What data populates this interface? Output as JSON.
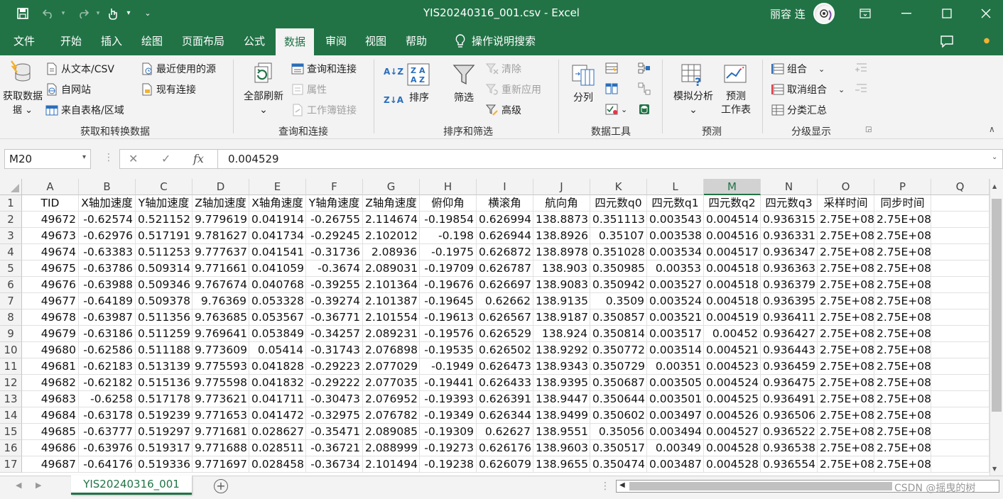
{
  "app": {
    "title": "YIS20240316_001.csv  -  Excel",
    "user_name": "丽容 连",
    "accent": "#217346"
  },
  "tabs": [
    "文件",
    "开始",
    "插入",
    "绘图",
    "页面布局",
    "公式",
    "数据",
    "审阅",
    "视图",
    "帮助",
    "操作说明搜索"
  ],
  "active_tab": "数据",
  "ribbon": {
    "get_data": "获取数据",
    "from_text": "从文本/CSV",
    "from_web": "自网站",
    "from_table": "来自表格/区域",
    "recent_sources": "最近使用的源",
    "existing_conn": "现有连接",
    "group_get": "获取和转换数据",
    "refresh_all": "全部刷新",
    "queries_conn": "查询和连接",
    "properties": "属性",
    "edit_links": "工作簿链接",
    "group_query": "查询和连接",
    "sort": "排序",
    "filter": "筛选",
    "clear": "清除",
    "reapply": "重新应用",
    "advanced": "高级",
    "group_sort": "排序和筛选",
    "text_to_cols": "分列",
    "group_tools": "数据工具",
    "what_if": "模拟分析",
    "forecast_sheet_1": "预测",
    "forecast_sheet_2": "工作表",
    "group_forecast": "预测",
    "group_cmd": "组合",
    "ungroup": "取消组合",
    "subtotal": "分类汇总",
    "group_outline": "分级显示"
  },
  "formula_bar": {
    "name_box": "M20",
    "value": "0.004529",
    "fx": "fx"
  },
  "sheet": {
    "columns": [
      "A",
      "B",
      "C",
      "D",
      "E",
      "F",
      "G",
      "H",
      "I",
      "J",
      "K",
      "L",
      "M",
      "N",
      "O",
      "P",
      "Q"
    ],
    "selected_column": "M",
    "row_numbers": [
      "1",
      "2",
      "3",
      "4",
      "5",
      "6",
      "7",
      "8",
      "9",
      "10",
      "11",
      "12",
      "13",
      "14",
      "15",
      "16",
      "17"
    ],
    "header": [
      "TID",
      "X轴加速度",
      "Y轴加速度",
      "Z轴加速度",
      "X轴角速度",
      "Y轴角速度",
      "Z轴角速度",
      "俯仰角",
      "横滚角",
      "航向角",
      "四元数q0",
      "四元数q1",
      "四元数q2",
      "四元数q3",
      "采样时间",
      "同步时间"
    ],
    "rows": [
      [
        "49672",
        "-0.62574",
        "0.521152",
        "9.779619",
        "0.041914",
        "-0.26755",
        "2.114674",
        "-0.19854",
        "0.626994",
        "138.8873",
        "0.351113",
        "0.003543",
        "0.004514",
        "0.936315",
        "2.75E+08",
        "2.75E+08"
      ],
      [
        "49673",
        "-0.62976",
        "0.517191",
        "9.781627",
        "0.041734",
        "-0.29245",
        "2.102012",
        "-0.198",
        "0.626944",
        "138.8926",
        "0.35107",
        "0.003538",
        "0.004516",
        "0.936331",
        "2.75E+08",
        "2.75E+08"
      ],
      [
        "49674",
        "-0.63383",
        "0.511253",
        "9.777637",
        "0.041541",
        "-0.31736",
        "2.08936",
        "-0.1975",
        "0.626872",
        "138.8978",
        "0.351028",
        "0.003534",
        "0.004517",
        "0.936347",
        "2.75E+08",
        "2.75E+08"
      ],
      [
        "49675",
        "-0.63786",
        "0.509314",
        "9.771661",
        "0.041059",
        "-0.3674",
        "2.089031",
        "-0.19709",
        "0.626787",
        "138.903",
        "0.350985",
        "0.00353",
        "0.004518",
        "0.936363",
        "2.75E+08",
        "2.75E+08"
      ],
      [
        "49676",
        "-0.63988",
        "0.509346",
        "9.767674",
        "0.040768",
        "-0.39255",
        "2.101364",
        "-0.19676",
        "0.626697",
        "138.9083",
        "0.350942",
        "0.003527",
        "0.004518",
        "0.936379",
        "2.75E+08",
        "2.75E+08"
      ],
      [
        "49677",
        "-0.64189",
        "0.509378",
        "9.76369",
        "0.053328",
        "-0.39274",
        "2.101387",
        "-0.19645",
        "0.62662",
        "138.9135",
        "0.3509",
        "0.003524",
        "0.004518",
        "0.936395",
        "2.75E+08",
        "2.75E+08"
      ],
      [
        "49678",
        "-0.63987",
        "0.511356",
        "9.763685",
        "0.053567",
        "-0.36771",
        "2.101554",
        "-0.19613",
        "0.626567",
        "138.9187",
        "0.350857",
        "0.003521",
        "0.004519",
        "0.936411",
        "2.75E+08",
        "2.75E+08"
      ],
      [
        "49679",
        "-0.63186",
        "0.511259",
        "9.769641",
        "0.053849",
        "-0.34257",
        "2.089231",
        "-0.19576",
        "0.626529",
        "138.924",
        "0.350814",
        "0.003517",
        "0.00452",
        "0.936427",
        "2.75E+08",
        "2.75E+08"
      ],
      [
        "49680",
        "-0.62586",
        "0.511188",
        "9.773609",
        "0.05414",
        "-0.31743",
        "2.076898",
        "-0.19535",
        "0.626502",
        "138.9292",
        "0.350772",
        "0.003514",
        "0.004521",
        "0.936443",
        "2.75E+08",
        "2.75E+08"
      ],
      [
        "49681",
        "-0.62183",
        "0.513139",
        "9.775593",
        "0.041828",
        "-0.29223",
        "2.077029",
        "-0.1949",
        "0.626473",
        "138.9343",
        "0.350729",
        "0.00351",
        "0.004523",
        "0.936459",
        "2.75E+08",
        "2.75E+08"
      ],
      [
        "49682",
        "-0.62182",
        "0.515136",
        "9.775598",
        "0.041832",
        "-0.29222",
        "2.077035",
        "-0.19441",
        "0.626433",
        "138.9395",
        "0.350687",
        "0.003505",
        "0.004524",
        "0.936475",
        "2.75E+08",
        "2.75E+08"
      ],
      [
        "49683",
        "-0.6258",
        "0.517178",
        "9.773621",
        "0.041711",
        "-0.30473",
        "2.076952",
        "-0.19393",
        "0.626391",
        "138.9447",
        "0.350644",
        "0.003501",
        "0.004525",
        "0.936491",
        "2.75E+08",
        "2.75E+08"
      ],
      [
        "49684",
        "-0.63178",
        "0.519239",
        "9.771653",
        "0.041472",
        "-0.32975",
        "2.076782",
        "-0.19349",
        "0.626344",
        "138.9499",
        "0.350602",
        "0.003497",
        "0.004526",
        "0.936506",
        "2.75E+08",
        "2.75E+08"
      ],
      [
        "49685",
        "-0.63777",
        "0.519297",
        "9.771681",
        "0.028627",
        "-0.35471",
        "2.089085",
        "-0.19309",
        "0.62627",
        "138.9551",
        "0.35056",
        "0.003494",
        "0.004527",
        "0.936522",
        "2.75E+08",
        "2.75E+08"
      ],
      [
        "49686",
        "-0.63976",
        "0.519317",
        "9.771688",
        "0.028511",
        "-0.36721",
        "2.088999",
        "-0.19273",
        "0.626176",
        "138.9603",
        "0.350517",
        "0.00349",
        "0.004528",
        "0.936538",
        "2.75E+08",
        "2.75E+08"
      ],
      [
        "49687",
        "-0.64176",
        "0.519336",
        "9.771697",
        "0.028458",
        "-0.36734",
        "2.101494",
        "-0.19238",
        "0.626079",
        "138.9655",
        "0.350474",
        "0.003487",
        "0.004528",
        "0.936554",
        "2.75E+08",
        "2.75E+08"
      ]
    ]
  },
  "sheet_tab": "YIS20240316_001",
  "watermark": "CSDN @摇曳的树"
}
